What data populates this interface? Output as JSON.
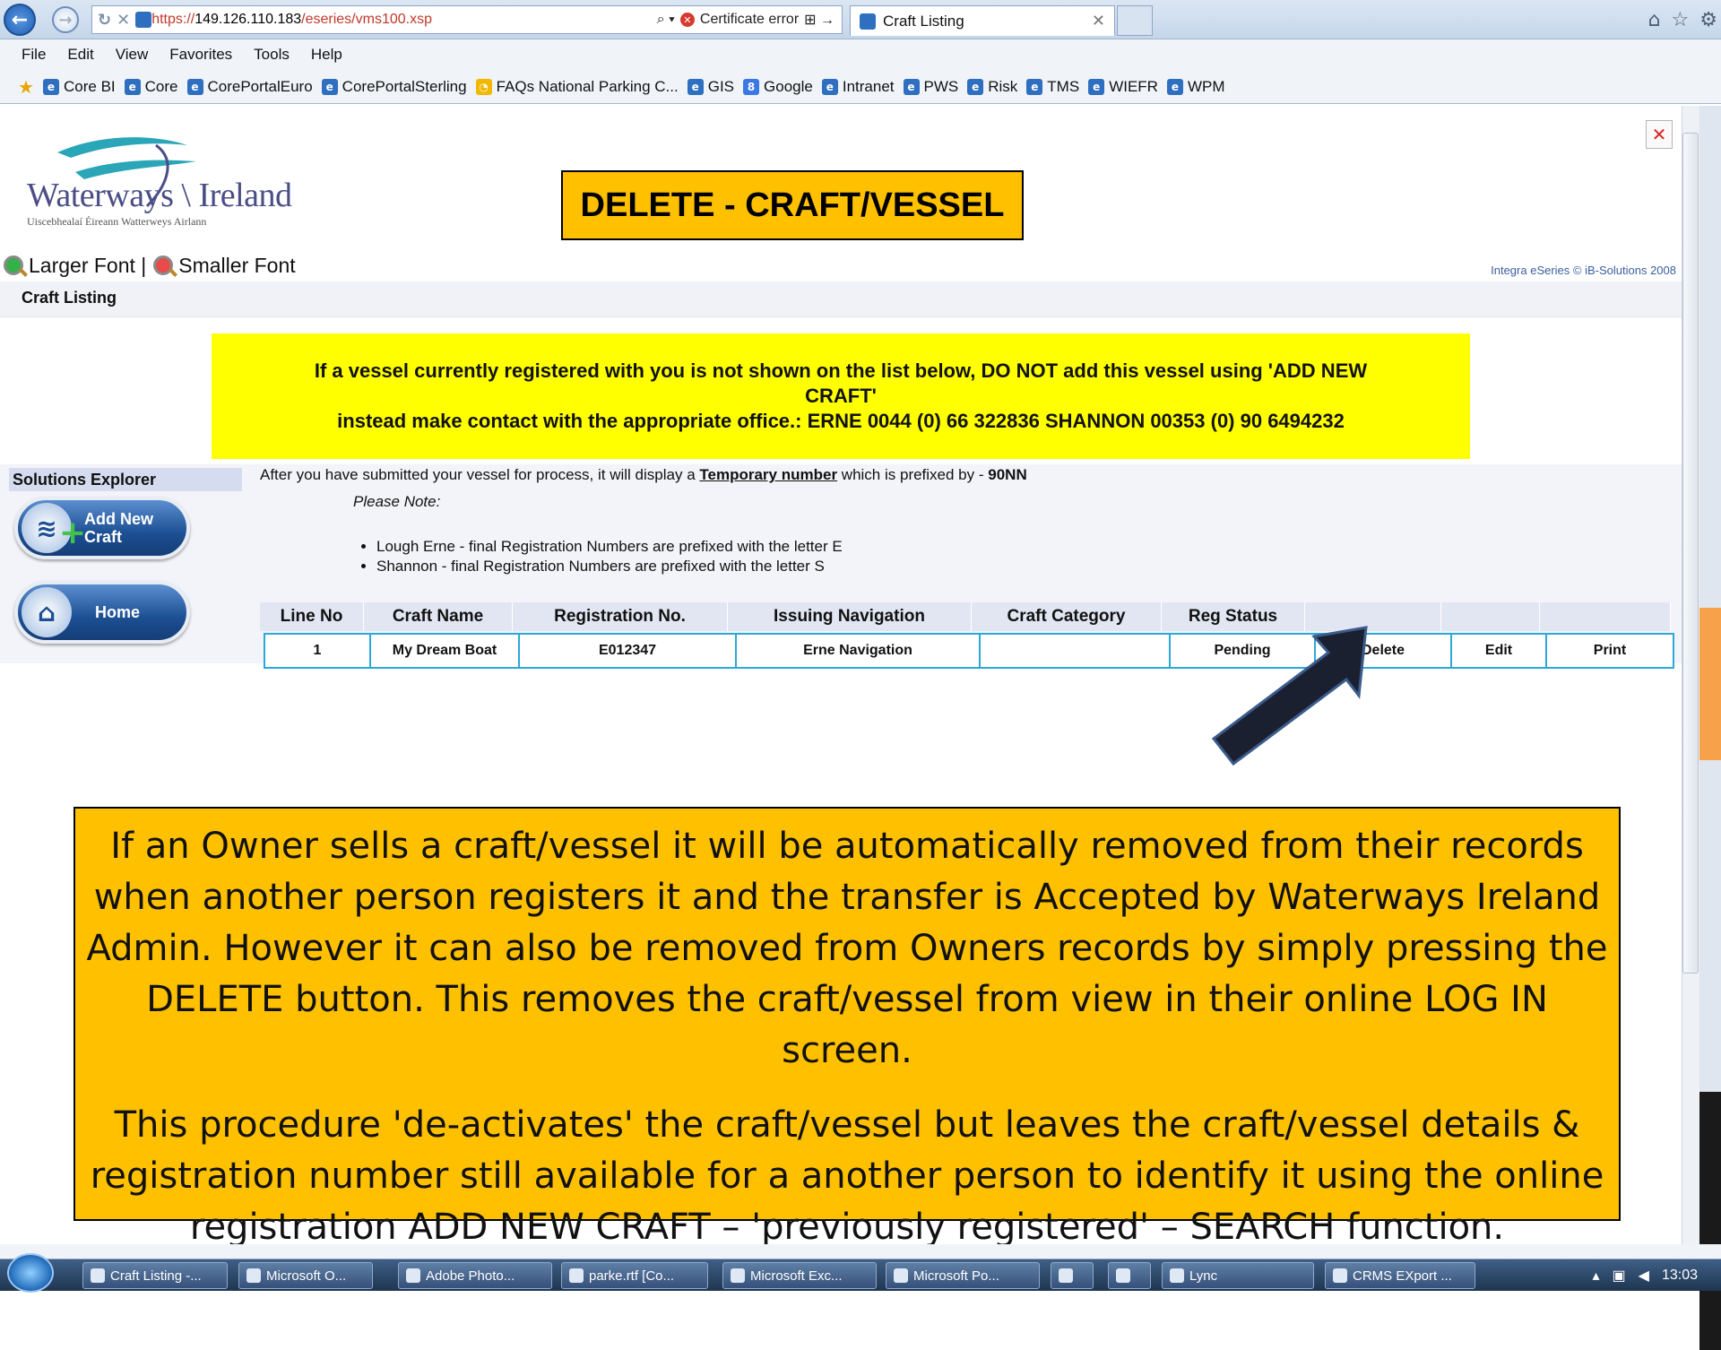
{
  "browser": {
    "url_scheme": "https://",
    "url_host": "149.126.110.183",
    "url_path": "/eseries/vms100.xsp",
    "cert_error": "Certificate error",
    "tab_title": "Craft Listing",
    "menu": [
      "File",
      "Edit",
      "View",
      "Favorites",
      "Tools",
      "Help"
    ],
    "favorites": [
      "Core BI",
      "Core",
      "CorePortalEuro",
      "CorePortalSterling",
      "FAQs National Parking C...",
      "GIS",
      "Google",
      "Intranet",
      "PWS",
      "Risk",
      "TMS",
      "WIEFR",
      "WPM"
    ]
  },
  "header": {
    "logo_name": "Waterways",
    "logo_name2": "Ireland",
    "logo_sub": "Uiscebhealaí Éireann   Watterweys Airlann",
    "slide_title": "DELETE - CRAFT/VESSEL",
    "larger_font": "Larger Font |",
    "smaller_font": "Smaller Font",
    "copyright": "Integra eSeries © iB-Solutions 2008",
    "breadcrumb": "Craft Listing"
  },
  "notice": {
    "line1": "If a vessel currently registered with you is not shown on the list below, DO NOT add this vessel using 'ADD NEW CRAFT'",
    "line2": "instead make contact with the appropriate office.: ERNE 0044 (0) 66 322836 SHANNON 00353 (0) 90 6494232"
  },
  "sidebar": {
    "title": "Solutions Explorer",
    "add_new": "Add New Craft",
    "add_new_l1": "Add New",
    "add_new_l2": "Craft",
    "home": "Home"
  },
  "info": {
    "prefix": "After you have submitted your vessel for process, it will display a",
    "temp": "Temporary number",
    "suffix": "which is prefixed by -",
    "code": "90NN",
    "note_label": "Please Note:",
    "notes": [
      "Lough Erne - final Registration Numbers are prefixed with the letter E",
      "Shannon - final Registration Numbers are prefixed with the letter S"
    ]
  },
  "table": {
    "headers": [
      "Line No",
      "Craft Name",
      "Registration No.",
      "Issuing Navigation",
      "Craft Category",
      "Reg Status",
      "",
      "",
      ""
    ],
    "row": {
      "line_no": "1",
      "craft_name": "My Dream Boat",
      "reg_no": "E012347",
      "navigation": "Erne Navigation",
      "category": "",
      "status": "Pending",
      "delete": "Delete",
      "edit": "Edit",
      "print": "Print"
    }
  },
  "callout": {
    "p1": "If an Owner sells a craft/vessel it will be automatically removed from their records when another person registers it and the transfer is Accepted by Waterways Ireland Admin.  However it can also be removed from Owners records by simply pressing the DELETE button.  This removes the craft/vessel from view in their online LOG IN screen.",
    "p2": "This procedure 'de-activates' the craft/vessel but leaves the craft/vessel details & registration number still available for a another person to identify it using the online registration ADD NEW CRAFT – 'previously registered' – SEARCH function."
  },
  "taskbar": {
    "items": [
      "Craft Listing -...",
      "Microsoft O...",
      "Adobe Photo...",
      "parke.rtf [Co...",
      "Microsoft Exc...",
      "Microsoft Po...",
      "Lync",
      "CRMS EXport ..."
    ],
    "clock": "13:03"
  },
  "colors": {
    "title_box": "#ffc000",
    "notice": "#ffff00",
    "row_border": "#2ba8d9",
    "button_blue": "#1c4f93"
  }
}
